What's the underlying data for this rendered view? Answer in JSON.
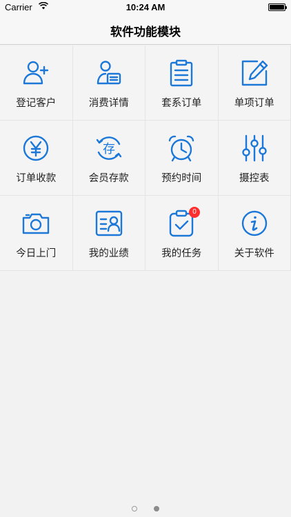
{
  "status_bar": {
    "carrier": "Carrier",
    "time": "10:24 AM"
  },
  "nav": {
    "title": "软件功能模块"
  },
  "accent_color": "#1b77d8",
  "badge_color": "#ff2e2e",
  "menu": [
    {
      "label": "登记客户",
      "icon": "add-user-icon"
    },
    {
      "label": "消费详情",
      "icon": "user-card-icon"
    },
    {
      "label": "套系订单",
      "icon": "clipboard-icon"
    },
    {
      "label": "单项订单",
      "icon": "edit-icon"
    },
    {
      "label": "订单收款",
      "icon": "yen-icon"
    },
    {
      "label": "会员存款",
      "icon": "deposit-icon"
    },
    {
      "label": "预约时间",
      "icon": "alarm-clock-icon"
    },
    {
      "label": "摄控表",
      "icon": "sliders-icon"
    },
    {
      "label": "今日上门",
      "icon": "camera-icon"
    },
    {
      "label": "我的业绩",
      "icon": "performance-icon"
    },
    {
      "label": "我的任务",
      "icon": "task-icon",
      "badge": "0"
    },
    {
      "label": "关于软件",
      "icon": "info-icon"
    }
  ],
  "pager": {
    "pages": 2,
    "current": 2
  }
}
